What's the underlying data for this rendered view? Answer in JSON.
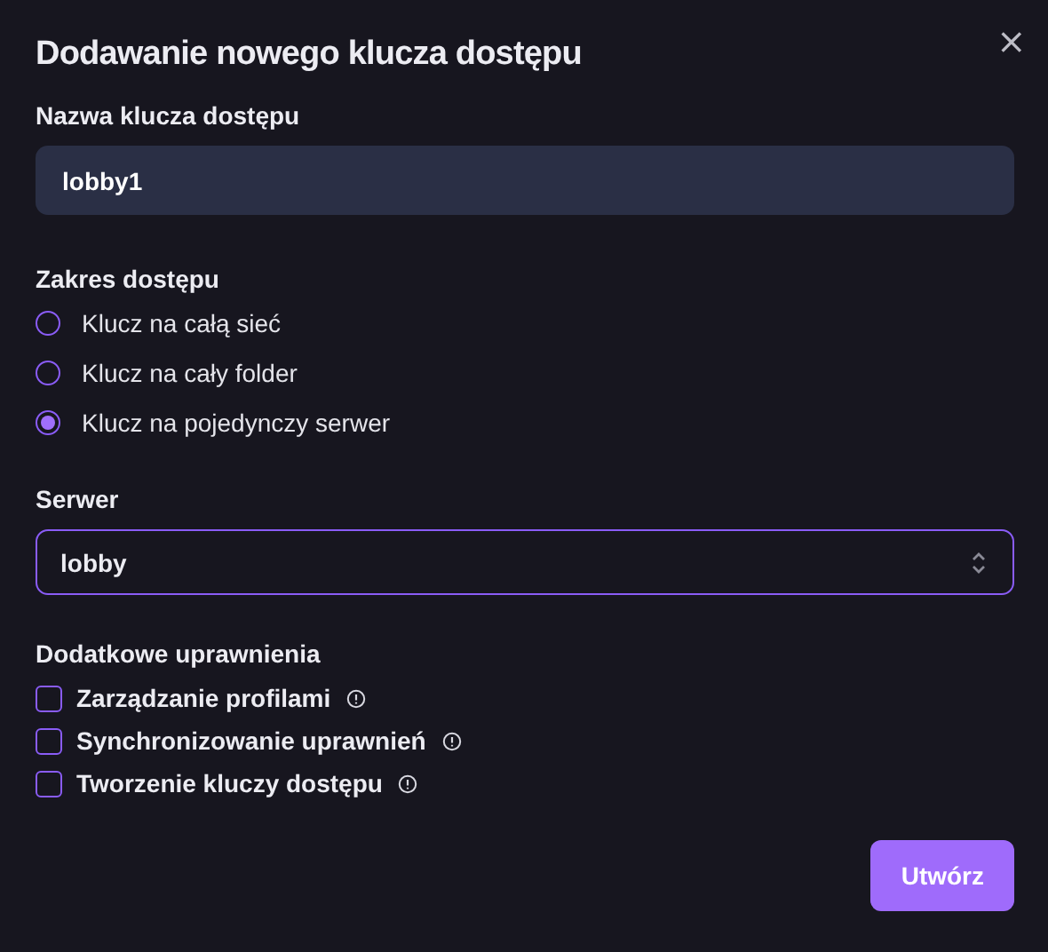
{
  "dialog": {
    "title": "Dodawanie nowego klucza dostępu",
    "close": "×"
  },
  "name_field": {
    "label": "Nazwa klucza dostępu",
    "value": "lobby1"
  },
  "scope": {
    "label": "Zakres dostępu",
    "options": [
      {
        "label": "Klucz na całą sieć",
        "selected": false
      },
      {
        "label": "Klucz na cały folder",
        "selected": false
      },
      {
        "label": "Klucz na pojedynczy serwer",
        "selected": true
      }
    ]
  },
  "server": {
    "label": "Serwer",
    "value": "lobby"
  },
  "permissions": {
    "label": "Dodatkowe uprawnienia",
    "items": [
      {
        "label": "Zarządzanie profilami",
        "checked": false
      },
      {
        "label": "Synchronizowanie uprawnień",
        "checked": false
      },
      {
        "label": "Tworzenie kluczy dostępu",
        "checked": false
      }
    ]
  },
  "buttons": [
    "Utwórz"
  ]
}
